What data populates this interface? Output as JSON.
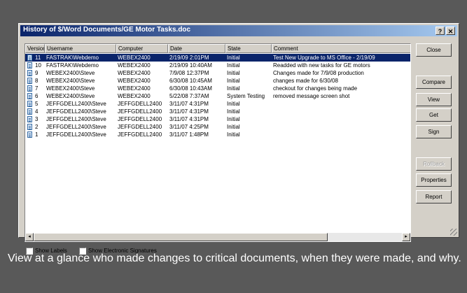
{
  "window": {
    "title": "History of $/Word Documents/GE Motor Tasks.doc",
    "help_label": "?",
    "close_label": "✕"
  },
  "columns": [
    "Version",
    "Username",
    "Computer",
    "Date",
    "State",
    "Comment"
  ],
  "rows": [
    {
      "version": "11",
      "username": "FASTRAK\\Webdemo",
      "computer": "WEBEX2400",
      "date": "2/19/09 2:01PM",
      "state": "Initial",
      "comment": "Test New Upgrade to MS Office - 2/19/09",
      "selected": true
    },
    {
      "version": "10",
      "username": "FASTRAK\\Webdemo",
      "computer": "WEBEX2400",
      "date": "2/19/09 10:40AM",
      "state": "Initial",
      "comment": "Readded with new tasks for GE motors"
    },
    {
      "version": "9",
      "username": "WEBEX2400\\Steve",
      "computer": "WEBEX2400",
      "date": "7/9/08 12:37PM",
      "state": "Initial",
      "comment": "Changes made for 7/9/08 production"
    },
    {
      "version": "8",
      "username": "WEBEX2400\\Steve",
      "computer": "WEBEX2400",
      "date": "6/30/08 10:45AM",
      "state": "Initial",
      "comment": "changes made for 6/30/08"
    },
    {
      "version": "7",
      "username": "WEBEX2400\\Steve",
      "computer": "WEBEX2400",
      "date": "6/30/08 10:43AM",
      "state": "Initial",
      "comment": "checkout for changes being made"
    },
    {
      "version": "6",
      "username": "WEBEX2400\\Steve",
      "computer": "WEBEX2400",
      "date": "5/22/08 7:37AM",
      "state": "System Testing",
      "comment": "removed message screen shot"
    },
    {
      "version": "5",
      "username": "JEFFGDELL2400\\Steve",
      "computer": "JEFFGDELL2400",
      "date": "3/11/07 4:31PM",
      "state": "Initial",
      "comment": ""
    },
    {
      "version": "4",
      "username": "JEFFGDELL2400\\Steve",
      "computer": "JEFFGDELL2400",
      "date": "3/11/07 4:31PM",
      "state": "Initial",
      "comment": ""
    },
    {
      "version": "3",
      "username": "JEFFGDELL2400\\Steve",
      "computer": "JEFFGDELL2400",
      "date": "3/11/07 4:31PM",
      "state": "Initial",
      "comment": ""
    },
    {
      "version": "2",
      "username": "JEFFGDELL2400\\Steve",
      "computer": "JEFFGDELL2400",
      "date": "3/11/07 4:25PM",
      "state": "Initial",
      "comment": ""
    },
    {
      "version": "1",
      "username": "JEFFGDELL2400\\Steve",
      "computer": "JEFFGDELL2400",
      "date": "3/11/07 1:48PM",
      "state": "Initial",
      "comment": ""
    }
  ],
  "buttons": {
    "close": "Close",
    "compare": "Compare",
    "view": "View",
    "get": "Get",
    "sign": "Sign",
    "rollback": "Rollback",
    "properties": "Properties",
    "report": "Report"
  },
  "checkboxes": {
    "show_labels": "Show Labels",
    "show_signatures": "Show Electronic Signatures"
  },
  "scroll": {
    "left_arrow": "◂",
    "right_arrow": "▸"
  },
  "caption": "View at a glance who made changes to critical documents, when they were made, and why.",
  "colors": {
    "background": "#595959",
    "selection": "#0a246a",
    "dialog": "#d4d0c8"
  }
}
